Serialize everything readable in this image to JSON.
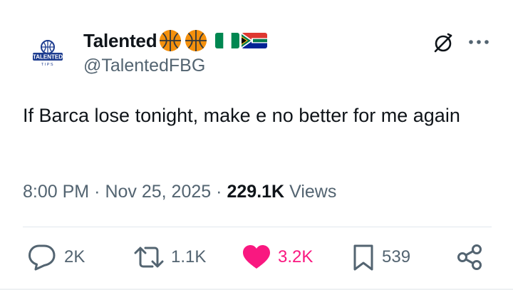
{
  "author": {
    "display_name": "Talented",
    "handle": "@TalentedFBG",
    "avatar_logo_text": "TALENTED",
    "avatar_logo_subtext": "TIPS",
    "name_emojis": [
      "basketball",
      "basketball",
      "flag-nigeria",
      "flag-south-africa"
    ]
  },
  "tweet": {
    "text": "If Barca lose tonight, make e no better for me again"
  },
  "meta": {
    "time": "8:00 PM",
    "separator": "·",
    "date": "Nov 25, 2025",
    "views_count": "229.1K",
    "views_label": "Views"
  },
  "actions": {
    "replies": "2K",
    "reposts": "1.1K",
    "likes": "3.2K",
    "bookmarks": "539"
  },
  "icons": {
    "header": [
      "grok-icon",
      "more-icon"
    ],
    "actions": [
      "reply-icon",
      "repost-icon",
      "like-icon",
      "bookmark-icon",
      "share-icon"
    ]
  },
  "colors": {
    "text_primary": "#0f1419",
    "text_secondary": "#536471",
    "like_active": "#f91880",
    "logo_blue": "#1d3c8f",
    "divider": "#e1e8ed"
  }
}
